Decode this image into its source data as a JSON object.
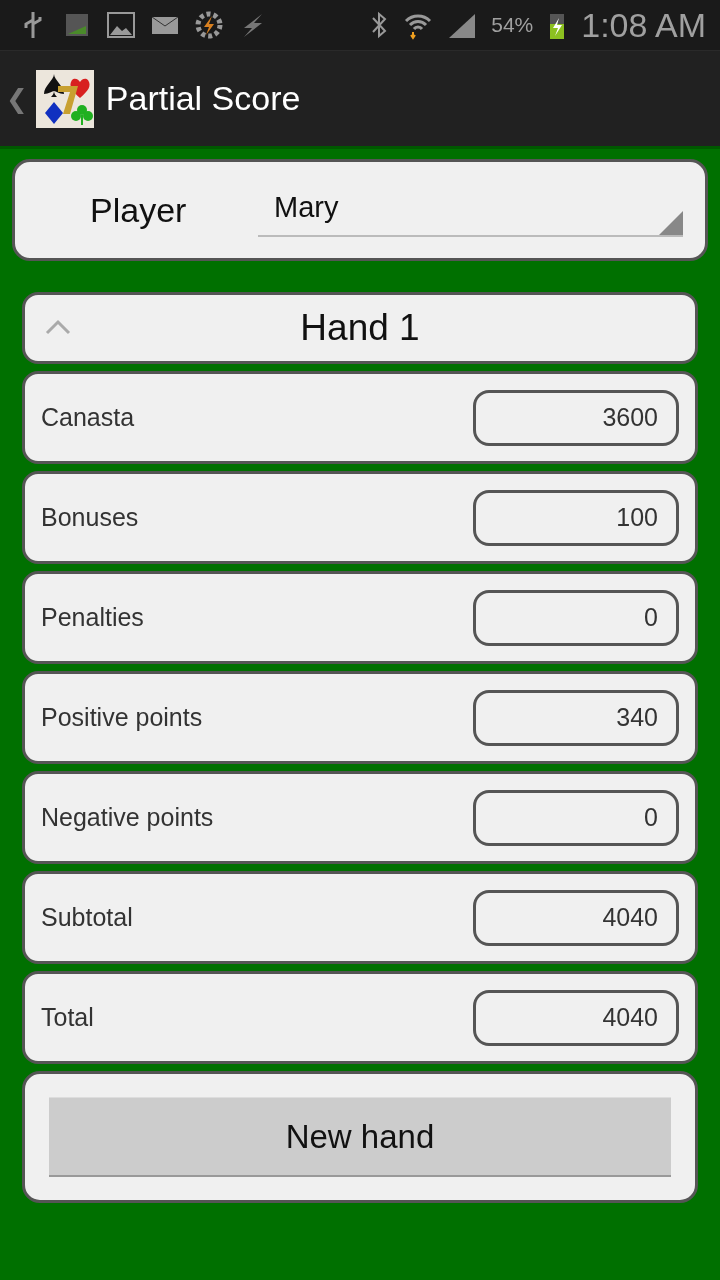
{
  "status_bar": {
    "battery": "54%",
    "time": "1:08 AM"
  },
  "action_bar": {
    "back": "❮",
    "title": "Partial Score"
  },
  "player": {
    "label": "Player",
    "value": "Mary"
  },
  "hand": {
    "title": "Hand 1",
    "expanded": true
  },
  "rows": [
    {
      "label": "Canasta",
      "value": "3600"
    },
    {
      "label": "Bonuses",
      "value": "100"
    },
    {
      "label": "Penalties",
      "value": "0"
    },
    {
      "label": "Positive points",
      "value": "340"
    },
    {
      "label": "Negative points",
      "value": "0"
    },
    {
      "label": "Subtotal",
      "value": "4040"
    },
    {
      "label": "Total",
      "value": "4040"
    }
  ],
  "button": "New hand"
}
